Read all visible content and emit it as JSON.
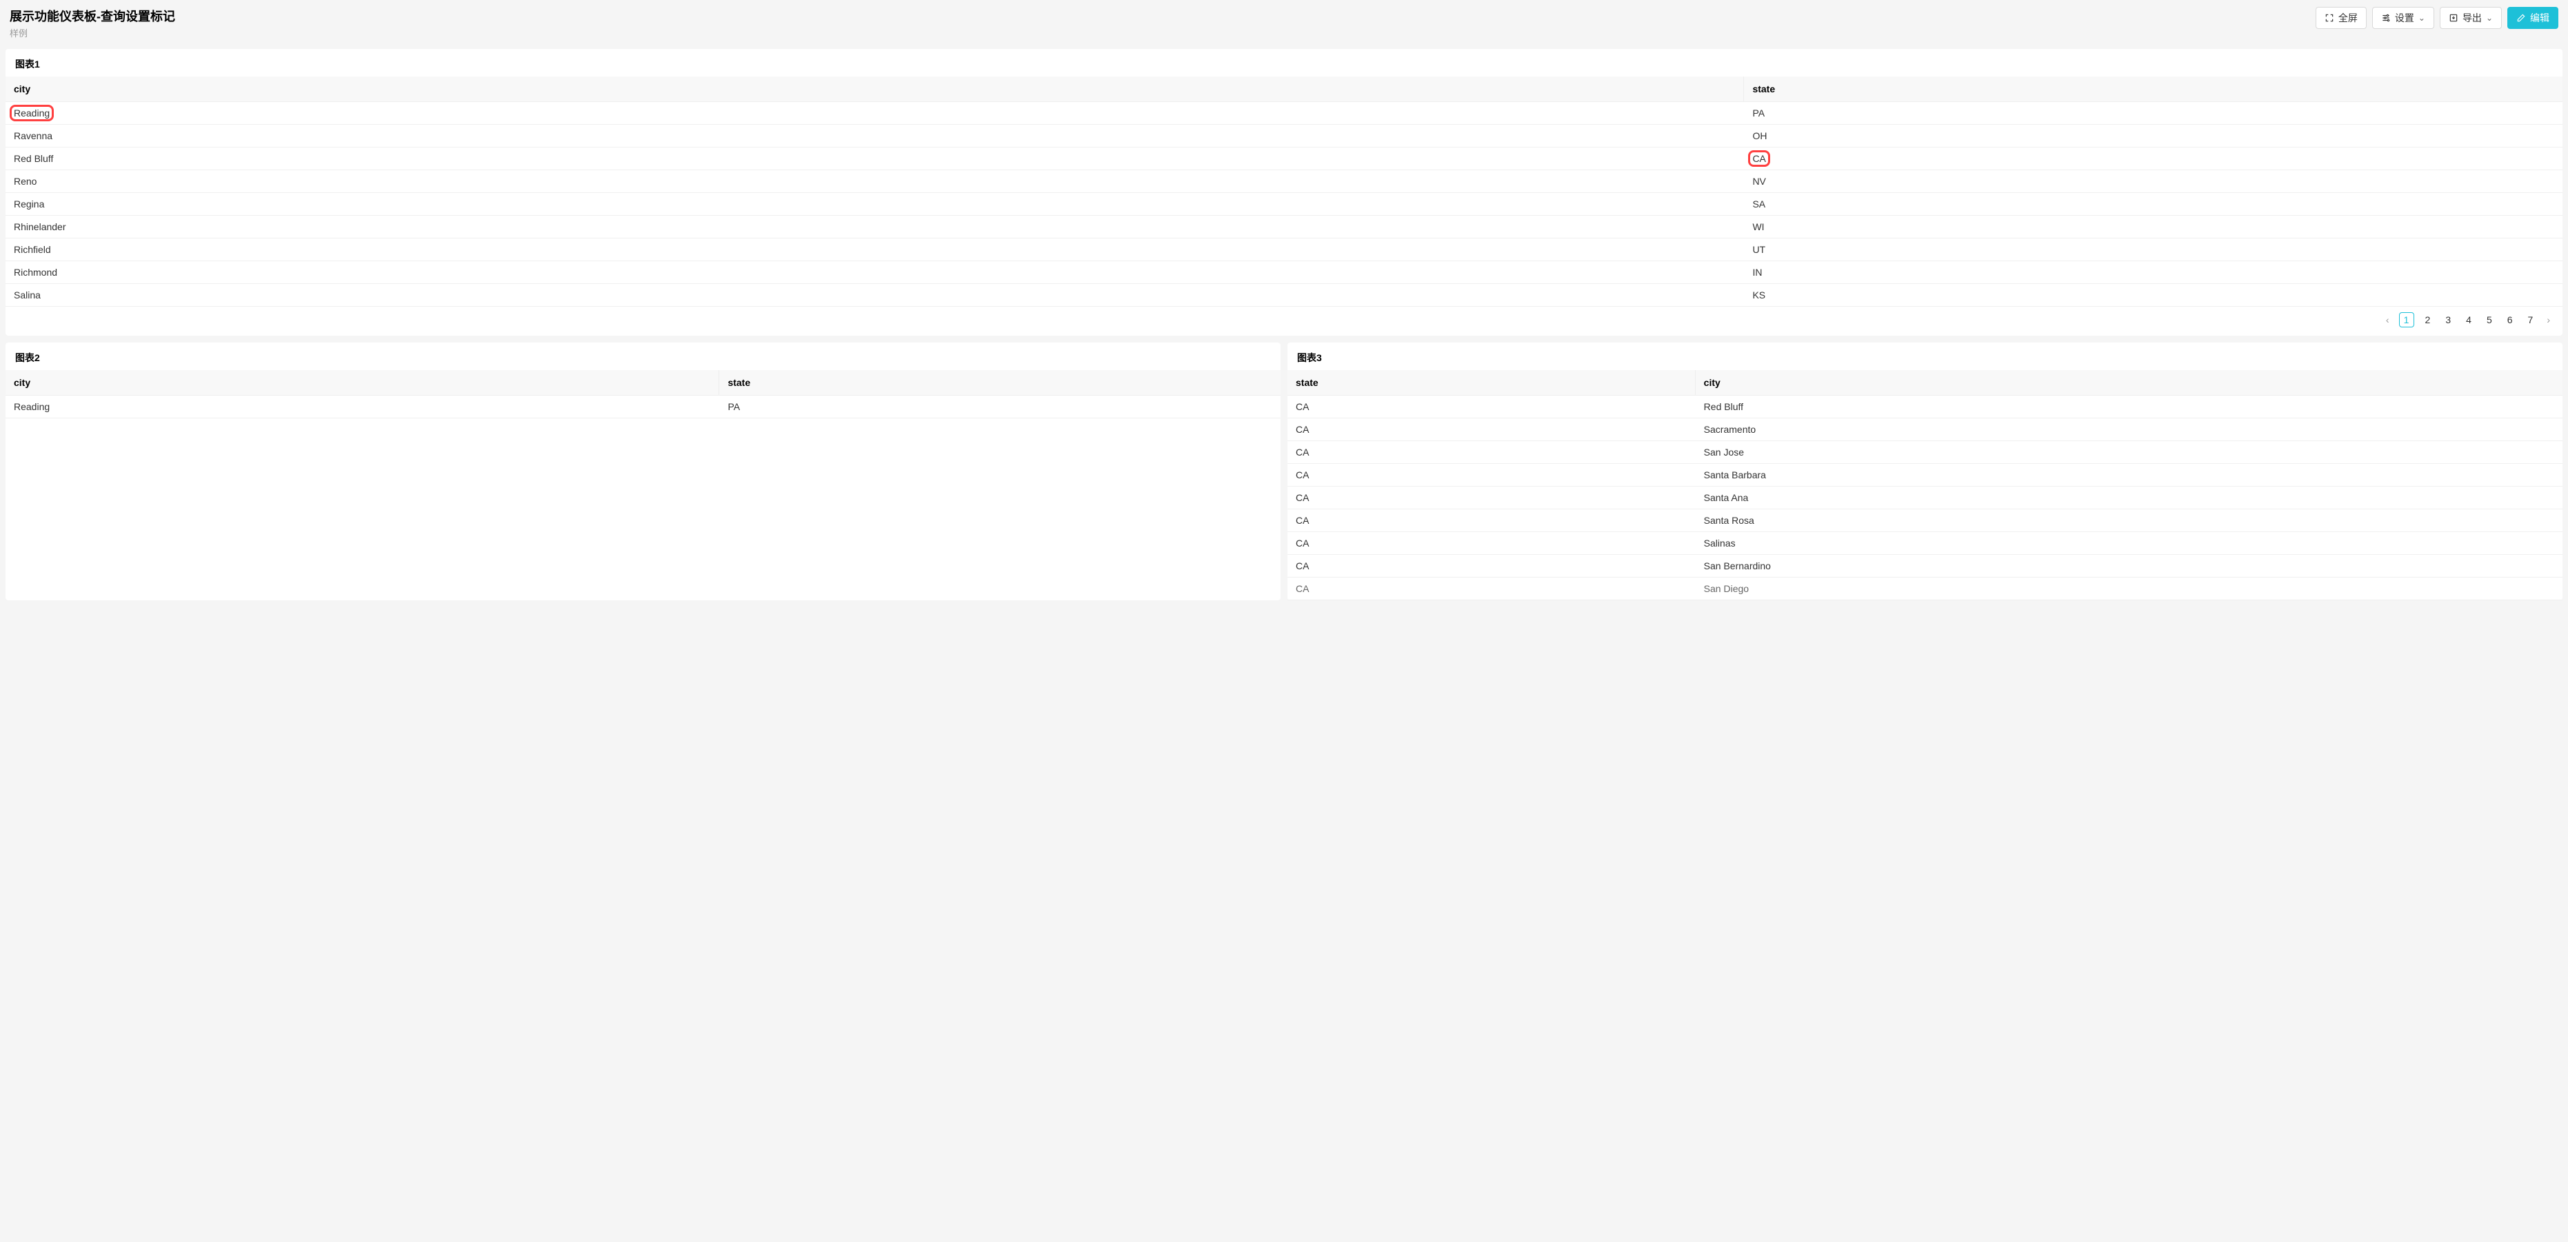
{
  "header": {
    "title": "展示功能仪表板-查询设置标记",
    "subtitle": "样例",
    "buttons": {
      "fullscreen": "全屏",
      "settings": "设置",
      "export": "导出",
      "edit": "编辑"
    }
  },
  "chart1": {
    "title": "图表1",
    "columns": {
      "city": "city",
      "state": "state"
    },
    "rows": [
      {
        "city": "Reading",
        "state": "PA",
        "city_hl": true
      },
      {
        "city": "Ravenna",
        "state": "OH"
      },
      {
        "city": "Red Bluff",
        "state": "CA",
        "state_hl": true
      },
      {
        "city": "Reno",
        "state": "NV"
      },
      {
        "city": "Regina",
        "state": "SA"
      },
      {
        "city": "Rhinelander",
        "state": "WI"
      },
      {
        "city": "Richfield",
        "state": "UT"
      },
      {
        "city": "Richmond",
        "state": "IN"
      },
      {
        "city": "Salina",
        "state": "KS"
      }
    ],
    "pager": {
      "pages": [
        "1",
        "2",
        "3",
        "4",
        "5",
        "6",
        "7"
      ],
      "active": "1"
    }
  },
  "chart2": {
    "title": "图表2",
    "columns": {
      "city": "city",
      "state": "state"
    },
    "rows": [
      {
        "city": "Reading",
        "state": "PA"
      }
    ]
  },
  "chart3": {
    "title": "图表3",
    "columns": {
      "state": "state",
      "city": "city"
    },
    "rows": [
      {
        "state": "CA",
        "city": "Red Bluff"
      },
      {
        "state": "CA",
        "city": "Sacramento"
      },
      {
        "state": "CA",
        "city": "San Jose"
      },
      {
        "state": "CA",
        "city": "Santa Barbara"
      },
      {
        "state": "CA",
        "city": "Santa Ana"
      },
      {
        "state": "CA",
        "city": "Santa Rosa"
      },
      {
        "state": "CA",
        "city": "Salinas"
      },
      {
        "state": "CA",
        "city": "San Bernardino"
      },
      {
        "state": "CA",
        "city": "San Diego"
      }
    ]
  }
}
